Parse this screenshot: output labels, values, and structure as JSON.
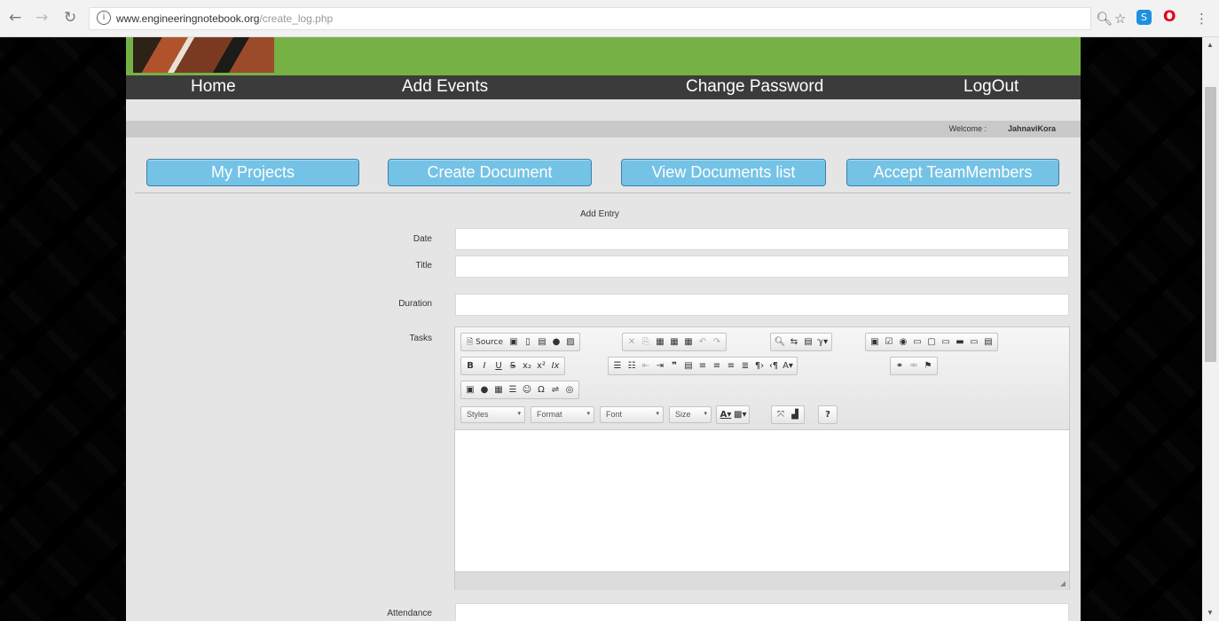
{
  "browser": {
    "url_host": "www.engineeringnotebook.org",
    "url_path": "/create_log.php"
  },
  "nav": {
    "home": "Home",
    "add_events": "Add Events",
    "change_password": "Change Password",
    "logout": "LogOut"
  },
  "welcome": {
    "label": "Welcome :",
    "user": "JahnaviKora"
  },
  "actions": {
    "my_projects": "My Projects",
    "create_document": "Create Document",
    "view_documents_list": "View Documents list",
    "accept_team_members": "Accept TeamMembers"
  },
  "form": {
    "title": "Add Entry",
    "date_label": "Date",
    "title_label": "Title",
    "duration_label": "Duration",
    "tasks_label": "Tasks",
    "attendance_label": "Attendance"
  },
  "editor": {
    "source_label": "Source",
    "styles": "Styles",
    "format": "Format",
    "font": "Font",
    "size": "Size",
    "help": "?"
  }
}
